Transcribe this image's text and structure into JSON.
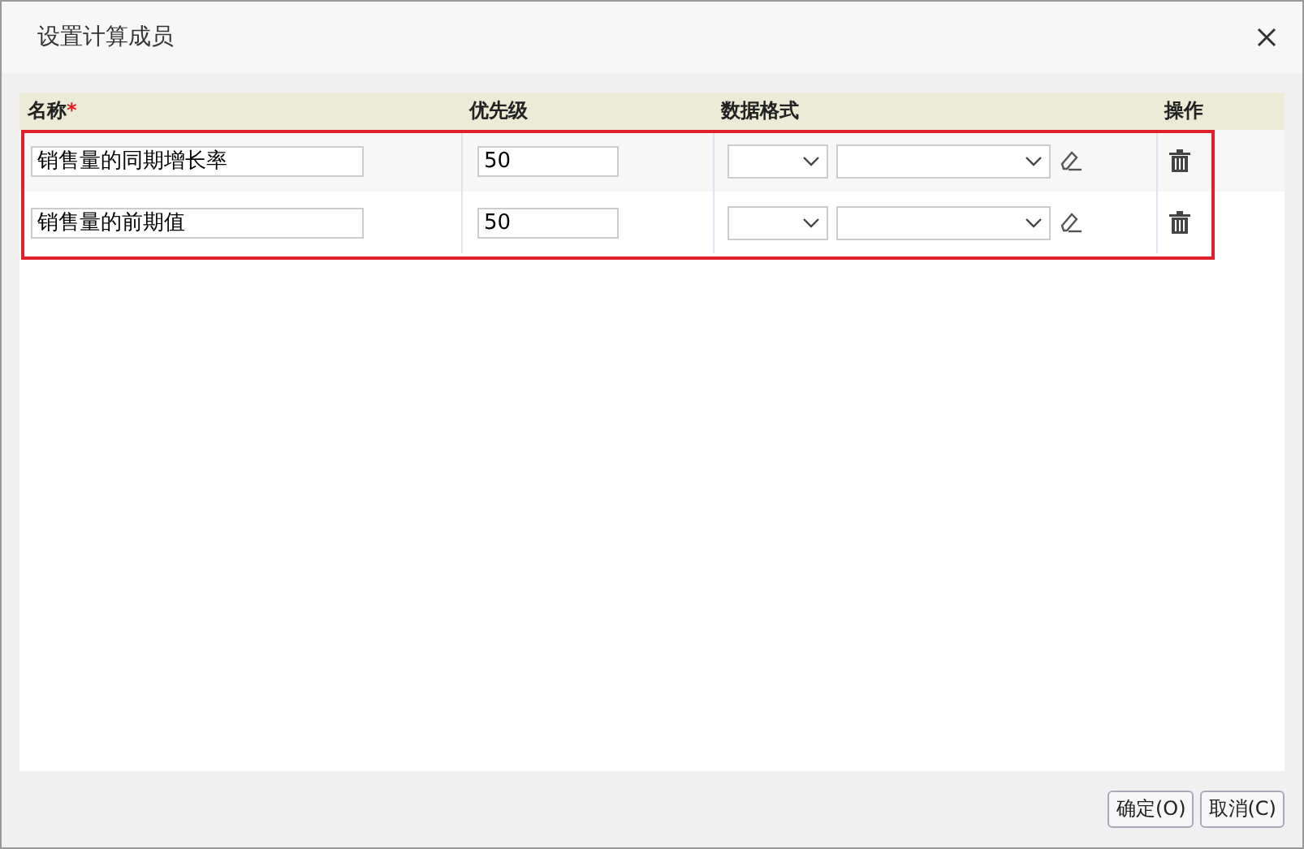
{
  "window": {
    "title": "设置计算成员"
  },
  "table": {
    "highlighted": true,
    "columns": [
      {
        "label": "名称",
        "required_mark": "*"
      },
      {
        "label": "优先级"
      },
      {
        "label": "数据格式"
      },
      {
        "label": "操作"
      }
    ],
    "rows": [
      {
        "name": "销售量的同期增长率",
        "priority": "50"
      },
      {
        "name": "销售量的前期值",
        "priority": "50"
      }
    ]
  },
  "buttons": [
    "确定(O)",
    "取消(C)"
  ]
}
